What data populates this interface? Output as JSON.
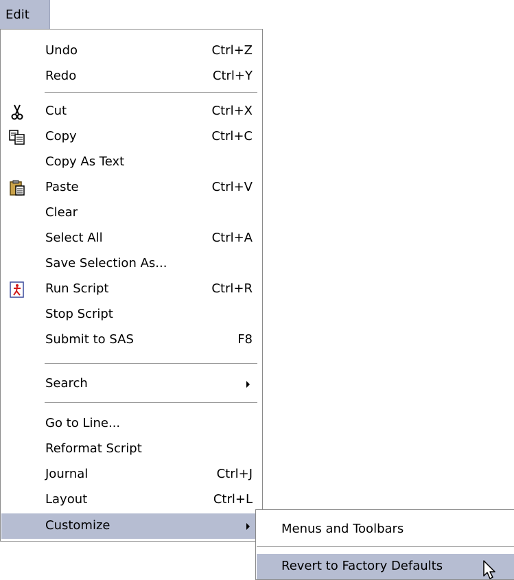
{
  "menubar": {
    "edit_label": "Edit"
  },
  "menu": {
    "items": [
      {
        "label": "Undo",
        "shortcut": "Ctrl+Z"
      },
      {
        "label": "Redo",
        "shortcut": "Ctrl+Y"
      },
      {
        "label": "Cut",
        "shortcut": "Ctrl+X",
        "icon": "scissors-icon"
      },
      {
        "label": "Copy",
        "shortcut": "Ctrl+C",
        "icon": "copy-icon"
      },
      {
        "label": "Copy As Text",
        "shortcut": ""
      },
      {
        "label": "Paste",
        "shortcut": "Ctrl+V",
        "icon": "paste-icon"
      },
      {
        "label": "Clear",
        "shortcut": ""
      },
      {
        "label": "Select All",
        "shortcut": "Ctrl+A"
      },
      {
        "label": "Save Selection As...",
        "shortcut": ""
      },
      {
        "label": "Run Script",
        "shortcut": "Ctrl+R",
        "icon": "run-script-icon"
      },
      {
        "label": "Stop Script",
        "shortcut": ""
      },
      {
        "label": "Submit to SAS",
        "shortcut": "F8"
      },
      {
        "label": "Search",
        "shortcut": ""
      },
      {
        "label": "Go to Line...",
        "shortcut": ""
      },
      {
        "label": "Reformat Script",
        "shortcut": ""
      },
      {
        "label": "Journal",
        "shortcut": "Ctrl+J"
      },
      {
        "label": "Layout",
        "shortcut": "Ctrl+L"
      },
      {
        "label": "Customize",
        "shortcut": ""
      }
    ]
  },
  "submenu": {
    "items": [
      {
        "label": "Menus and Toolbars"
      },
      {
        "label": "Revert to Factory Defaults"
      }
    ]
  },
  "colors": {
    "highlight": "#b6bdd2",
    "border": "#8a8a8a"
  }
}
